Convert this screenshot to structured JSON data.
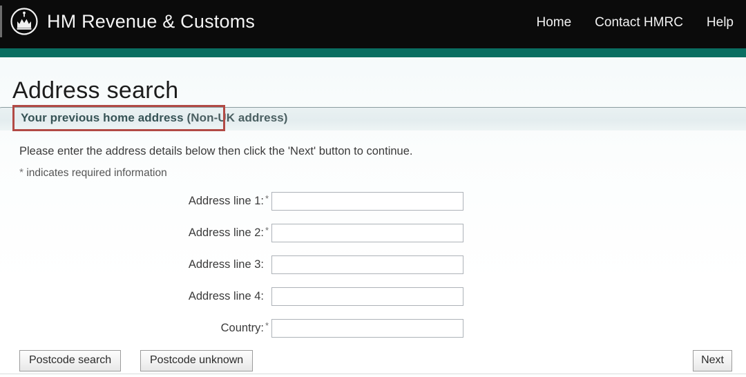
{
  "header": {
    "logo_icon": "crown-emblem-icon",
    "brand": "HM Revenue & Customs",
    "nav": [
      {
        "label": "Home"
      },
      {
        "label": "Contact HMRC"
      },
      {
        "label": "Help"
      }
    ],
    "bar_color": "#0b0b0b",
    "accent_color": "#0a6e61"
  },
  "page": {
    "title": "Address search"
  },
  "panel": {
    "title_strong": "Your previous home address",
    "title_suffix": " (Non-UK address)",
    "highlight_color": "#b24a45"
  },
  "instructions": {
    "intro": "Please enter the address details below then click the 'Next' button to continue.",
    "required_marker": "*",
    "required_note": " indicates required information"
  },
  "form": {
    "fields": [
      {
        "label": "Address line 1:",
        "required": "*",
        "value": "",
        "placeholder": ""
      },
      {
        "label": "Address line 2:",
        "required": "*",
        "value": "",
        "placeholder": ""
      },
      {
        "label": "Address line 3:",
        "required": "",
        "value": "",
        "placeholder": ""
      },
      {
        "label": "Address line 4:",
        "required": "",
        "value": "",
        "placeholder": ""
      },
      {
        "label": "Country:",
        "required": "*",
        "value": "",
        "placeholder": ""
      }
    ]
  },
  "actions": {
    "postcode_search": "Postcode search",
    "postcode_unknown": "Postcode unknown",
    "next": "Next"
  }
}
